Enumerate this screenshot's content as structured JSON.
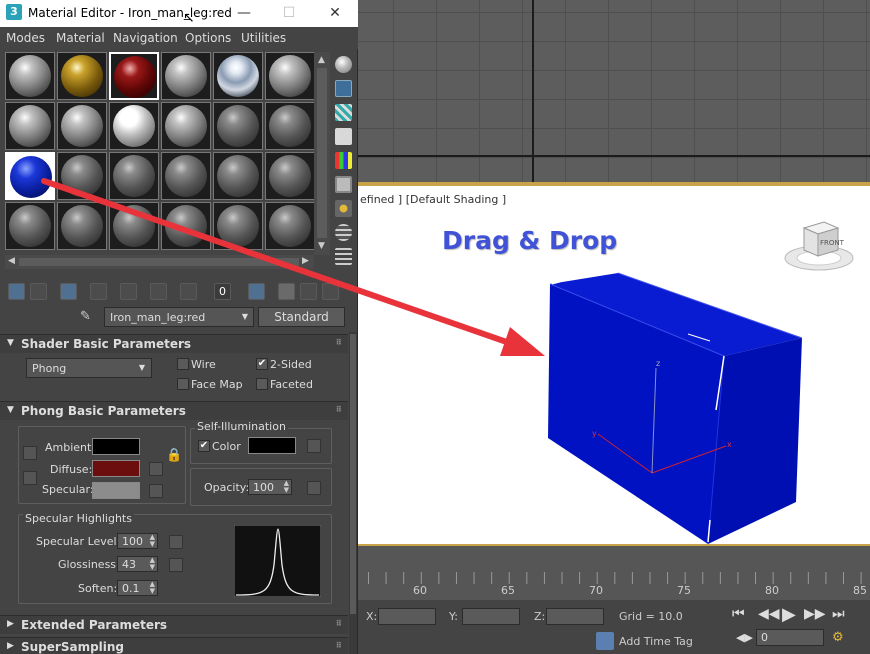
{
  "window": {
    "title": "Material Editor - Iron_man_leg:red",
    "minimize": "—",
    "maximize": "☐",
    "close": "✕",
    "logo": "3"
  },
  "menu": [
    "Modes",
    "Material",
    "Navigation",
    "Options",
    "Utilities"
  ],
  "slots": [
    [
      "default",
      "gold",
      "red",
      "default",
      "chrome",
      "default"
    ],
    [
      "default",
      "default",
      "bright",
      "default",
      "dark",
      "dark"
    ],
    [
      "blue",
      "dark",
      "dark",
      "dark",
      "dark",
      "dark"
    ],
    [
      "dark",
      "dark",
      "dark",
      "dark",
      "dark",
      "dark"
    ]
  ],
  "selected_slot": [
    2,
    0
  ],
  "material": {
    "name": "Iron_man_leg:red",
    "type": "Standard"
  },
  "shader_rollout": {
    "title": "Shader Basic Parameters",
    "shader": "Phong",
    "wire": {
      "label": "Wire",
      "checked": false
    },
    "two_sided": {
      "label": "2-Sided",
      "checked": true
    },
    "face_map": {
      "label": "Face Map",
      "checked": false
    },
    "faceted": {
      "label": "Faceted",
      "checked": false
    }
  },
  "phong_rollout": {
    "title": "Phong Basic Parameters",
    "ambient": {
      "label": "Ambient:",
      "color": "#000000"
    },
    "diffuse": {
      "label": "Diffuse:",
      "color": "#6d0e0e"
    },
    "specular": {
      "label": "Specular:",
      "color": "#8c8c8c"
    },
    "self_illum": {
      "title": "Self-Illumination",
      "color_label": "Color",
      "checked": true,
      "color": "#000000"
    },
    "opacity": {
      "label": "Opacity:",
      "value": "100"
    },
    "spec_highlights": {
      "title": "Specular Highlights",
      "level": {
        "label": "Specular Level:",
        "value": "100"
      },
      "glossiness": {
        "label": "Glossiness:",
        "value": "43"
      },
      "soften": {
        "label": "Soften:",
        "value": "0.1"
      }
    }
  },
  "collapsed_rollouts": [
    "Extended Parameters",
    "SuperSampling"
  ],
  "viewport": {
    "label": "efined ] [Default Shading ]",
    "annotation": "Drag & Drop",
    "box_color": "#0010c8",
    "viewcube_label": "FRONT",
    "axes": {
      "x": "x",
      "y": "y",
      "z": "z"
    }
  },
  "timeline": {
    "ticks": [
      "60",
      "65",
      "70",
      "75",
      "80",
      "85"
    ]
  },
  "status": {
    "x_label": "X:",
    "y_label": "Y:",
    "z_label": "Z:",
    "grid": "Grid = 10.0",
    "add_time_tag": "Add Time Tag",
    "frame": "0"
  },
  "accent_colors": {
    "arrow": "#e8333b",
    "viewport_border": "#c9a34a",
    "annotation": "#3f52d8"
  }
}
